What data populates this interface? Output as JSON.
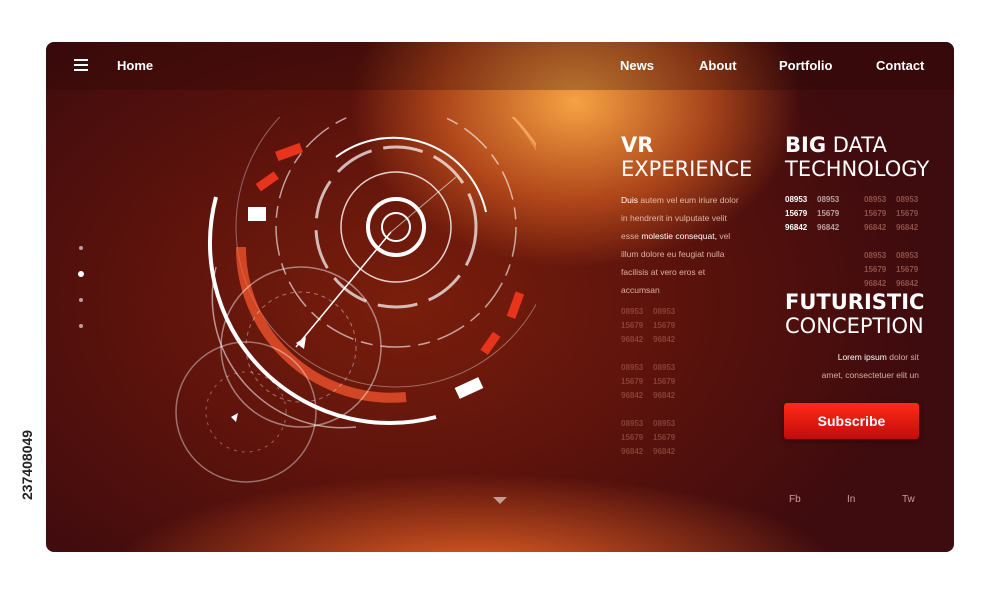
{
  "nav": {
    "home": "Home",
    "news": "News",
    "about": "About",
    "portfolio": "Portfolio",
    "contact": "Contact",
    "menu_icon": "hamburger-icon"
  },
  "vr": {
    "title_bold": "VR",
    "title_light": "EXPERIENCE",
    "p1_bold": "Duis",
    "p1_rest": "autem vel eum iriure dolor",
    "p2": "in hendrerit in vulputate velit",
    "p3_start": "esse",
    "p3_bold": "molestie consequat,",
    "p3_end": "vel",
    "p4": "illum dolore eu feugiat nulla",
    "p5": "facilisis at vero eros et",
    "p6": "accumsan"
  },
  "bigdata": {
    "title_bold": "BIG",
    "title_light1": "DATA",
    "title_light2": "TECHNOLOGY"
  },
  "numbers": [
    "08953",
    "15679",
    "96842"
  ],
  "futuristic": {
    "title_bold": "FUTURISTIC",
    "title_light": "CONCEPTION",
    "l1_bold": "Lorem ipsum",
    "l1_rest": "dolor sit",
    "l2": "amet, consectetuer elit un"
  },
  "subscribe": "Subscribe",
  "social": {
    "fb": "Fb",
    "in": "In",
    "tw": "Tw"
  },
  "stock_id": "237408049",
  "colors": {
    "accent": "#e01a10",
    "bg_dark": "#4a0e0c",
    "glow": "#ff9a40"
  }
}
